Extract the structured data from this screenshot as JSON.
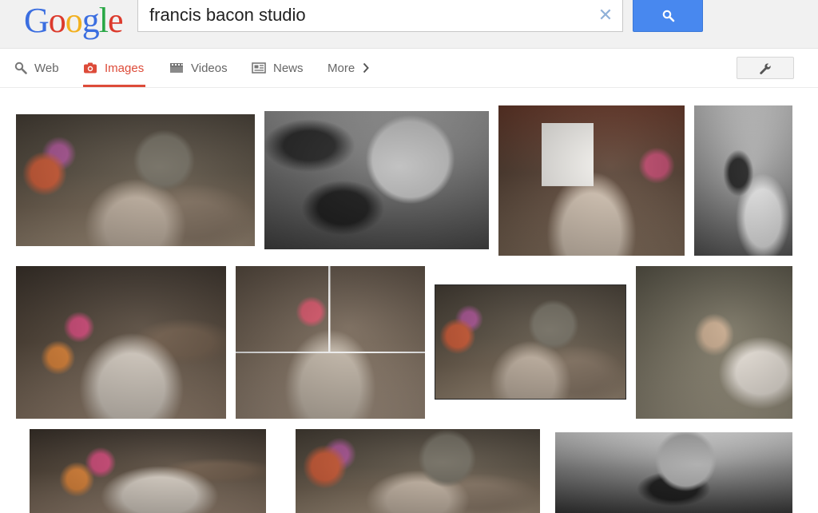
{
  "logo": {
    "letters": [
      "G",
      "o",
      "o",
      "g",
      "l",
      "e"
    ]
  },
  "search": {
    "query": "francis bacon studio",
    "clear_icon": "close-icon",
    "button_icon": "search-icon",
    "button_color": "#4888ef"
  },
  "nav": {
    "items": [
      {
        "label": "Web",
        "icon": "search-icon",
        "active": false
      },
      {
        "label": "Images",
        "icon": "camera-icon",
        "active": true
      },
      {
        "label": "Videos",
        "icon": "film-icon",
        "active": false
      },
      {
        "label": "News",
        "icon": "newspaper-icon",
        "active": false
      },
      {
        "label": "More",
        "icon": "chevron-right-icon",
        "active": false
      }
    ],
    "active_color": "#dd4b39",
    "tools_icon": "wrench-icon"
  },
  "results": [
    {
      "row": 1,
      "style": "color"
    },
    {
      "row": 1,
      "style": "black-and-white"
    },
    {
      "row": 1,
      "style": "color"
    },
    {
      "row": 1,
      "style": "black-and-white"
    },
    {
      "row": 2,
      "style": "color"
    },
    {
      "row": 2,
      "style": "collage"
    },
    {
      "row": 2,
      "style": "color"
    },
    {
      "row": 2,
      "style": "sepia"
    },
    {
      "row": 3,
      "style": "color"
    },
    {
      "row": 3,
      "style": "color"
    },
    {
      "row": 3,
      "style": "black-and-white"
    }
  ]
}
